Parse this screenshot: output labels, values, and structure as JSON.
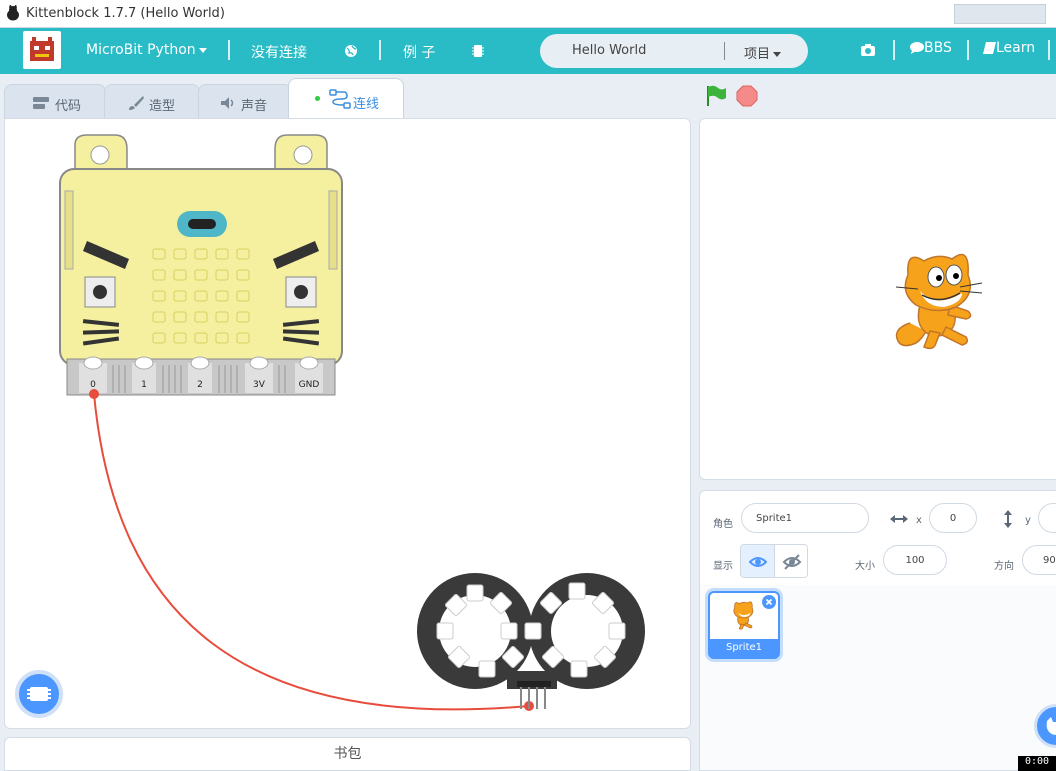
{
  "window": {
    "title": "Kittenblock 1.7.7 (Hello World)"
  },
  "menubar": {
    "mode": "MicroBit Python",
    "connection": "没有连接",
    "examples": "例 子",
    "project_name": "Hello World",
    "project_menu": "项目",
    "bbs": "BBS",
    "learn": "Learn"
  },
  "tabs": [
    {
      "label": "代码"
    },
    {
      "label": "造型"
    },
    {
      "label": "声音"
    },
    {
      "label": "连线",
      "active": true
    }
  ],
  "microbit_pins": [
    "0",
    "1",
    "2",
    "3V",
    "GND"
  ],
  "bookbag": "书包",
  "sprite_info": {
    "sprite_label": "角色",
    "sprite_name": "Sprite1",
    "x_label": "x",
    "x_value": "0",
    "y_label": "y",
    "show_label": "显示",
    "size_label": "大小",
    "size_value": "100",
    "direction_label": "方向",
    "direction_value": "90"
  },
  "sprites": [
    {
      "name": "Sprite1"
    }
  ],
  "timer": "0:00",
  "colors": {
    "accent": "#29bcc6",
    "active_tab": "#3a8fe0",
    "wire": "#e74c3c",
    "sprite_blue": "#4c97ff"
  }
}
